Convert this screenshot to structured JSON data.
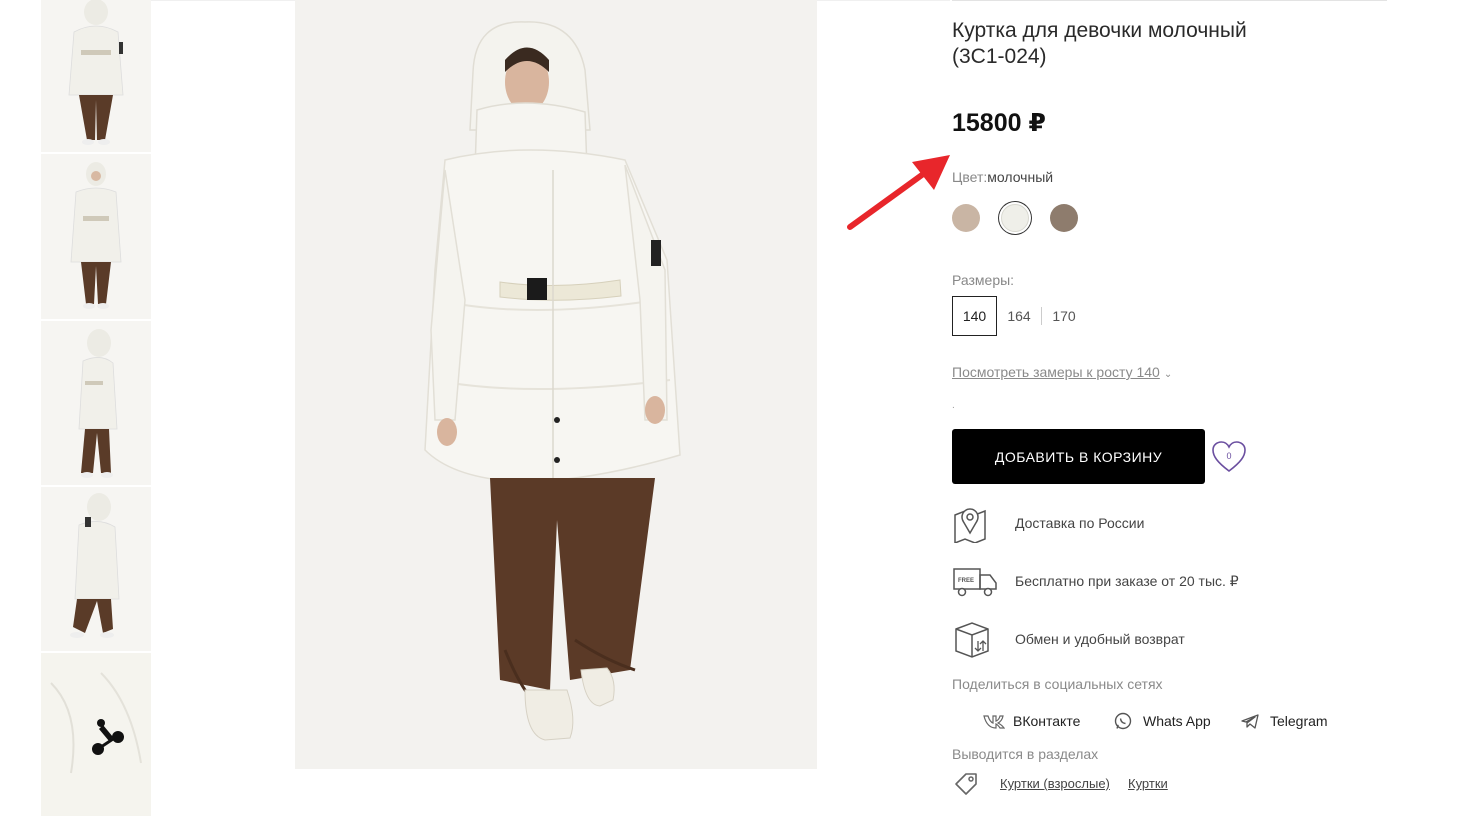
{
  "product": {
    "title_line1": "Куртка для девочки молочный",
    "title_line2": "(3С1-024)",
    "price": "15800 ₽"
  },
  "color": {
    "label": "Цвет:",
    "value": "молочный",
    "swatches": [
      {
        "name": "beige",
        "hex": "#c9b5a4"
      },
      {
        "name": "milk",
        "hex": "#efefe9"
      },
      {
        "name": "taupe",
        "hex": "#8e7c6d"
      }
    ]
  },
  "sizes": {
    "label": "Размеры:",
    "items": [
      "140",
      "164",
      "170"
    ],
    "active": "140"
  },
  "measure_link": "Посмотреть замеры к росту 140",
  "dot": ".",
  "cart_button": "ДОБАВИТЬ В КОРЗИНУ",
  "favorites_count": "0",
  "features": [
    {
      "icon": "map-pin-icon",
      "text": "Доставка по России"
    },
    {
      "icon": "free-truck-icon",
      "text": "Бесплатно при заказе от 20 тыс. ₽"
    },
    {
      "icon": "box-return-icon",
      "text": "Обмен и удобный возврат"
    }
  ],
  "share": {
    "label": "Поделиться в социальных сетях",
    "items": [
      "ВКонтакте",
      "Whats App",
      "Telegram"
    ]
  },
  "sections": {
    "label": "Выводится в разделах",
    "items": [
      "Куртки (взрослые)",
      "Куртки"
    ]
  },
  "colors": {
    "accent_arrow": "#e8262b",
    "button_bg": "#000000",
    "heart": "#6b4fa0"
  }
}
